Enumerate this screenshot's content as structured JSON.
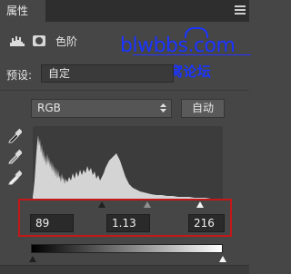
{
  "panel": {
    "tab_label": "属性",
    "title": "色阶"
  },
  "watermark": {
    "main": "blwbbs.com",
    "sub": "IT部落窝论坛"
  },
  "preset": {
    "label": "预设:",
    "value": "自定"
  },
  "channel": {
    "value": "RGB"
  },
  "auto_button": {
    "label": "自动"
  },
  "input_levels": {
    "black": "89",
    "gamma": "1.13",
    "white": "216"
  },
  "icons": [
    "levels-icon",
    "mask-icon",
    "eyedropper-black-icon",
    "eyedropper-gray-icon",
    "eyedropper-white-icon",
    "menu-icon",
    "updown-icon"
  ],
  "colors": {
    "panel_bg": "#464646",
    "highlight_box": "#c41818",
    "watermark": "#1a34ff"
  }
}
